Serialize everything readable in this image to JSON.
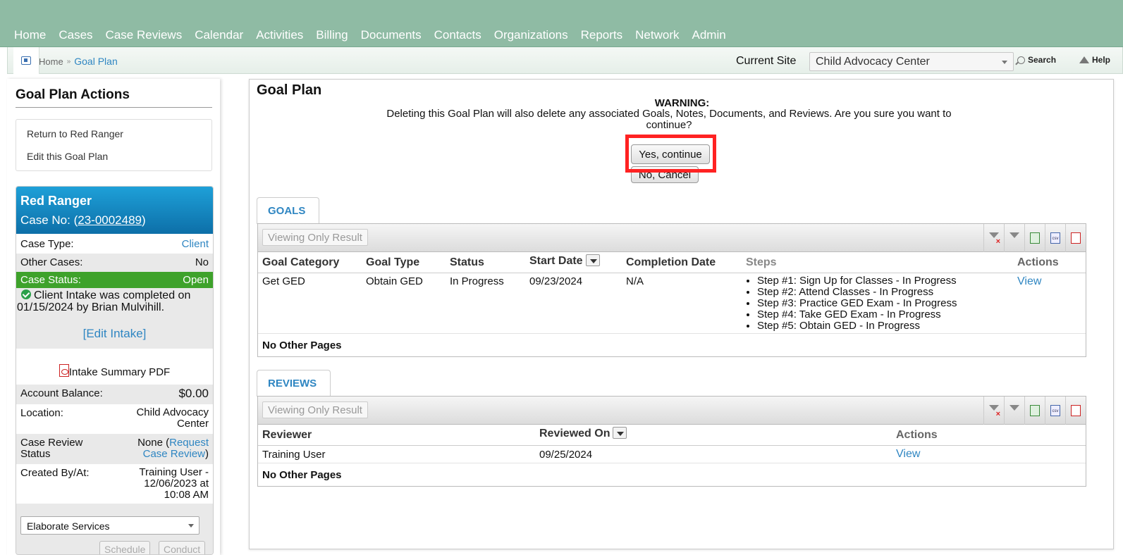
{
  "nav": [
    "Home",
    "Cases",
    "Case Reviews",
    "Calendar",
    "Activities",
    "Billing",
    "Documents",
    "Contacts",
    "Organizations",
    "Reports",
    "Network",
    "Admin"
  ],
  "breadcrumb": {
    "home": "Home",
    "separator": "»",
    "current": "Goal Plan"
  },
  "site": {
    "label": "Current Site",
    "value": "Child Advocacy Center"
  },
  "toplinks": {
    "search": "Search",
    "help": "Help"
  },
  "sidebar": {
    "title": "Goal Plan Actions",
    "actions": [
      "Return to Red Ranger",
      "Edit this Goal Plan"
    ],
    "case": {
      "name": "Red Ranger",
      "case_no_label": "Case No: (",
      "case_no": "23-0002489",
      "case_no_close": ")",
      "case_type_label": "Case Type:",
      "case_type": "Client",
      "other_cases_label": "Other Cases:",
      "other_cases": "No",
      "status_label": "Case Status:",
      "status": "Open",
      "intake_note": "Client Intake was completed on 01/15/2024 by Brian Mulvihill.",
      "edit_intake": "[Edit Intake]",
      "intake_pdf": "Intake Summary PDF",
      "balance_label": "Account Balance:",
      "balance": "$0.00",
      "location_label": "Location:",
      "location_line1": "Child Advocacy",
      "location_line2": "Center",
      "review_label_1": "Case Review",
      "review_label_2": "Status",
      "review_none": "None (",
      "review_link_1": "Request",
      "review_link_2": "Case Review",
      "review_close": ")",
      "created_label": "Created By/At:",
      "created_line1": "Training User -",
      "created_line2": "12/06/2023 at",
      "created_line3": "10:08 AM",
      "services": "Elaborate Services",
      "schedule": "Schedule",
      "conduct": "Conduct"
    }
  },
  "main": {
    "title": "Goal Plan",
    "warning_title": "WARNING:",
    "warning_message": "Deleting this Goal Plan will also delete any associated Goals, Notes, Documents, and Reviews. Are you sure you want to continue?",
    "yes": "Yes, continue",
    "no": "No, Cancel",
    "goals": {
      "tab": "GOALS",
      "viewing": "Viewing Only Result",
      "headers": [
        "Goal Category",
        "Goal Type",
        "Status",
        "Start Date",
        "Completion Date",
        "Steps",
        "Actions"
      ],
      "row": {
        "category": "Get GED",
        "type": "Obtain GED",
        "status": "In Progress",
        "start": "09/23/2024",
        "completion": "N/A",
        "steps": [
          "Step #1: Sign Up for Classes - In Progress",
          "Step #2: Attend Classes - In Progress",
          "Step #3: Practice GED Exam - In Progress",
          "Step #4: Take GED Exam - In Progress",
          "Step #5: Obtain GED - In Progress"
        ],
        "action": "View"
      },
      "footer": "No Other Pages"
    },
    "reviews": {
      "tab": "REVIEWS",
      "viewing": "Viewing Only Result",
      "headers": [
        "Reviewer",
        "Reviewed On",
        "Actions"
      ],
      "row": {
        "reviewer": "Training User",
        "reviewed_on": "09/25/2024",
        "action": "View"
      },
      "footer": "No Other Pages"
    },
    "tool_icons": [
      "clear-filter-icon",
      "filter-icon",
      "excel-export-icon",
      "csv-export-icon",
      "pdf-export-icon"
    ],
    "tool_csv_text": "csv"
  },
  "colors": {
    "topbar": "#8fbba4",
    "link": "#2f86c2",
    "status_green": "#3ea22b",
    "case_header": "#1588c4",
    "highlight": "#ff2222"
  }
}
